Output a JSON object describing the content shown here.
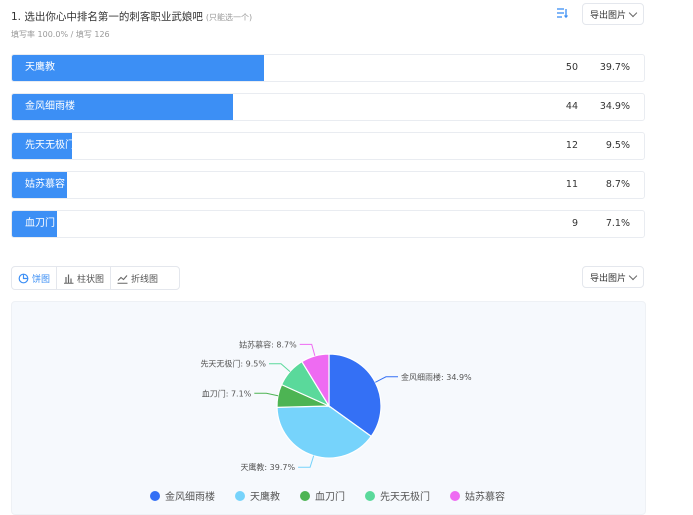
{
  "question": {
    "title": "1. 选出你心中排名第一的刺客职业武娘吧",
    "hint": "(只能选一个)",
    "fill_rate": "填写率 100.0% / 填写 126"
  },
  "toolbar": {
    "export_label": "导出图片"
  },
  "chart_tabs": [
    {
      "label": "饼图",
      "icon": "pie-chart-icon",
      "active": true
    },
    {
      "label": "柱状图",
      "icon": "bar-chart-icon",
      "active": false
    },
    {
      "label": "折线图",
      "icon": "line-chart-icon",
      "active": false
    }
  ],
  "chart_data": {
    "type": "pie",
    "slices": [
      {
        "label": "金风细雨楼",
        "count": 44,
        "percent": 34.9,
        "display": "34.9%",
        "color": "#3470f5"
      },
      {
        "label": "天鹰教",
        "count": 50,
        "percent": 39.7,
        "display": "39.7%",
        "color": "#76d3fb"
      },
      {
        "label": "血刀门",
        "count": 9,
        "percent": 7.1,
        "display": "7.1%",
        "color": "#4db453"
      },
      {
        "label": "先天无极门",
        "count": 12,
        "percent": 9.5,
        "display": "9.5%",
        "color": "#5ad99b"
      },
      {
        "label": "姑苏慕容",
        "count": 11,
        "percent": 8.7,
        "display": "8.7%",
        "color": "#ee6bf2"
      }
    ],
    "bars": [
      {
        "label": "天鹰教",
        "count": "50",
        "percent": "39.7%",
        "fraction": 0.397
      },
      {
        "label": "金风细雨楼",
        "count": "44",
        "percent": "34.9%",
        "fraction": 0.349
      },
      {
        "label": "先天无极门",
        "count": "12",
        "percent": "9.5%",
        "fraction": 0.095
      },
      {
        "label": "姑苏慕容",
        "count": "11",
        "percent": "8.7%",
        "fraction": 0.087
      },
      {
        "label": "血刀门",
        "count": "9",
        "percent": "7.1%",
        "fraction": 0.071
      }
    ],
    "bar_color": "#3c8ff5",
    "legend_placement": "bottom"
  }
}
